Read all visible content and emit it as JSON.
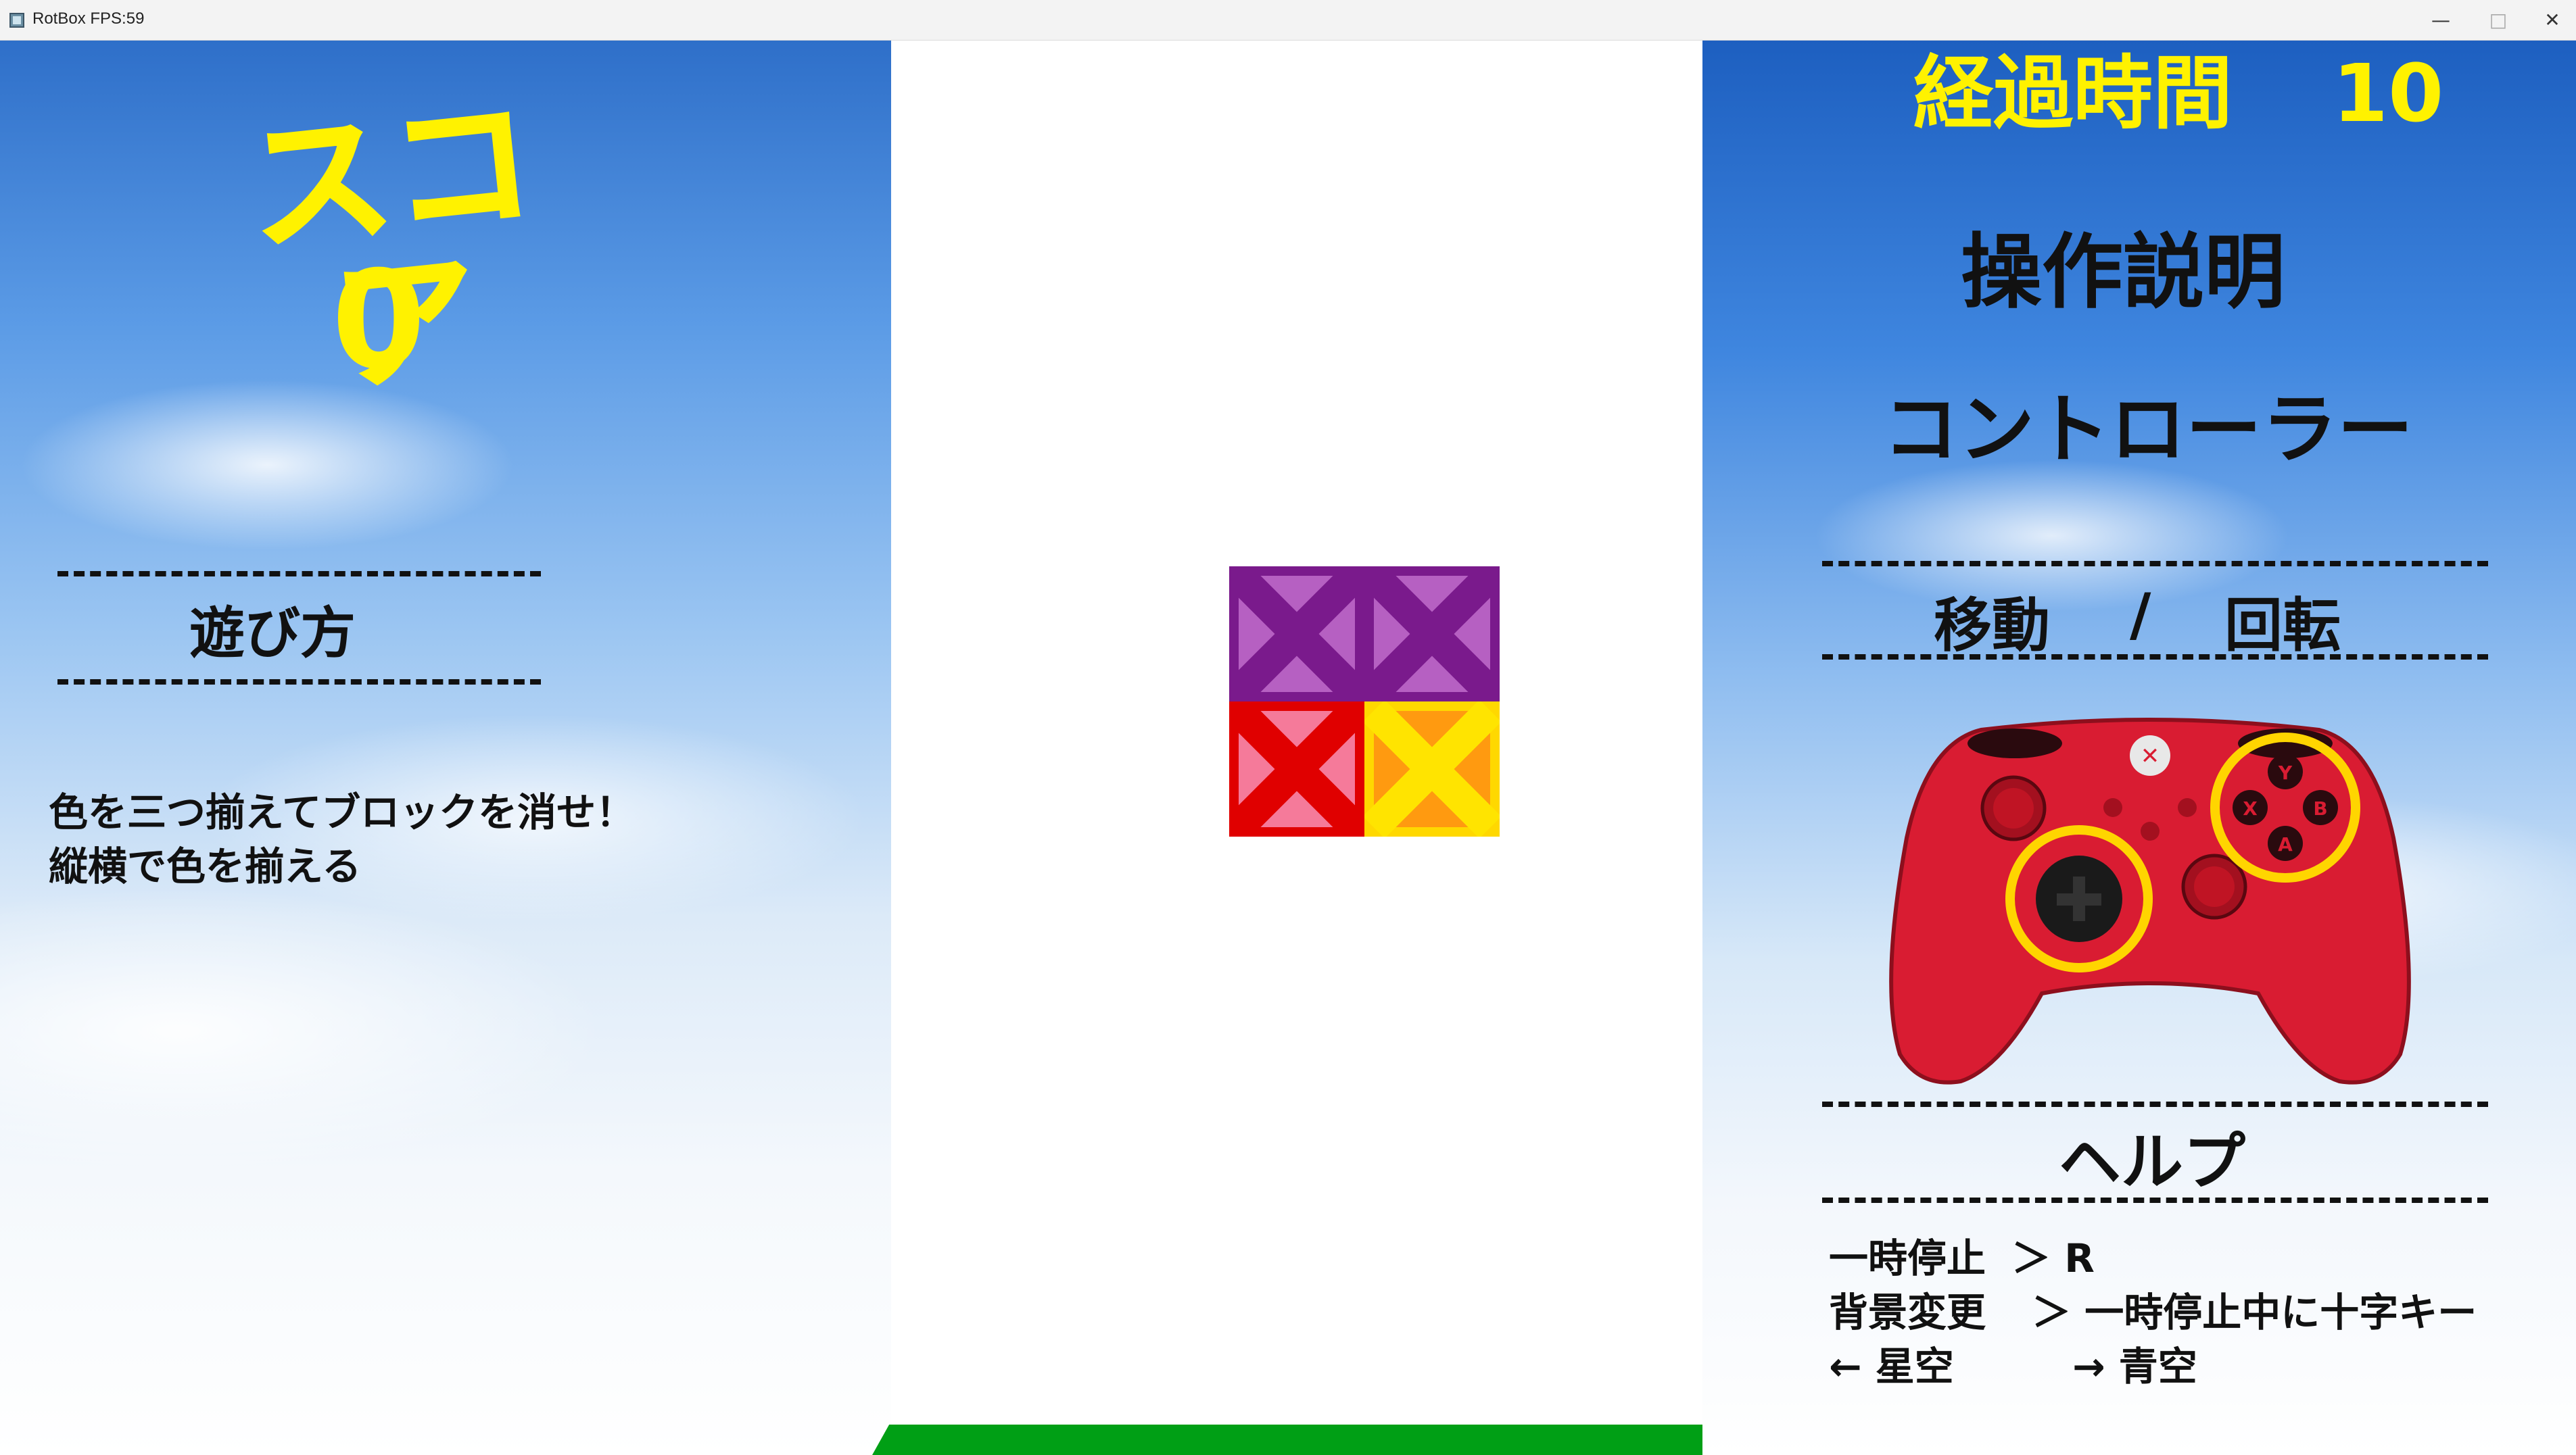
{
  "window": {
    "title": "RotBox FPS:59",
    "minimize_glyph": "—",
    "maximize_glyph": "□",
    "close_glyph": "✕"
  },
  "left_panel": {
    "score_label": "スコア",
    "score_value": "0",
    "howto_heading": "遊び方",
    "instructions": [
      "色を三つ揃えてブロックを消せ！",
      "縦横で色を揃える"
    ]
  },
  "right_panel": {
    "elapsed_label": "経過時間",
    "elapsed_value": "10",
    "controls_heading": "操作説明",
    "controller_heading": "コントローラー",
    "move_label": "移動",
    "separator": "/",
    "rotate_label": "回転",
    "help_heading": "ヘルプ",
    "help_lines": [
      {
        "left": "一時停止",
        "right": "＞ R"
      },
      {
        "left": "背景変更",
        "right": "＞ 一時停止中に十字キー"
      },
      {
        "left": "← 星空",
        "right": "→ 青空"
      }
    ],
    "controller_buttons": {
      "y": "Y",
      "x": "X",
      "b": "B",
      "a": "A"
    }
  },
  "blocks": [
    {
      "color_name": "purple",
      "fill": "#b660c2",
      "border": "#7a1a8c",
      "mark": "#7a1a8c"
    },
    {
      "color_name": "purple",
      "fill": "#b660c2",
      "border": "#7a1a8c",
      "mark": "#7a1a8c"
    },
    {
      "color_name": "red",
      "fill": "#f57a9a",
      "border": "#e00000",
      "mark": "#e00000"
    },
    {
      "color_name": "yellow",
      "fill": "#ff9a10",
      "border": "#ffd800",
      "mark": "#ffe400"
    }
  ],
  "colors": {
    "score_yellow": "#fff200",
    "floor_green": "#009f15",
    "controller_red": "#d91c32",
    "highlight_ring": "#ffd500"
  }
}
